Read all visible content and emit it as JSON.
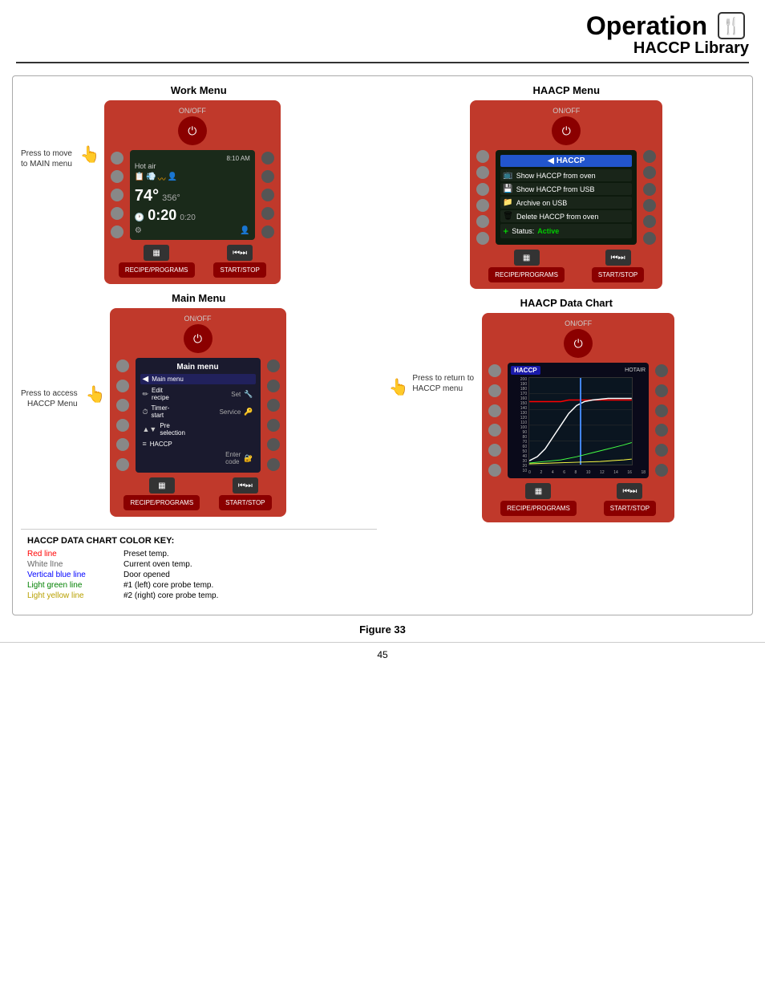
{
  "header": {
    "title": "Operation",
    "subtitle": "HACCP Library",
    "icon_alt": "chef-hat-icon"
  },
  "work_menu": {
    "label": "Work Menu",
    "onoff": "ON/OFF",
    "time": "8:10 AM",
    "hotair": "Hot air",
    "temp": "74°",
    "temp_sub": "356°",
    "timer": "0:20",
    "timer_sub": "0:20",
    "recipe_btn": "RECIPE/PROGRAMS",
    "start_btn": "START/STOP",
    "press_label": "Press to move\nto MAIN menu"
  },
  "haacp_menu": {
    "label": "HAACP Menu",
    "onoff": "ON/OFF",
    "title": "HACCP",
    "items": [
      {
        "icon": "📋",
        "text": "Show HACCP from oven"
      },
      {
        "icon": "💾",
        "text": "Show HACCP from USB"
      },
      {
        "icon": "📁",
        "text": "Archive on USB"
      },
      {
        "icon": "🗑",
        "text": "Delete HACCP from oven"
      },
      {
        "icon": "+",
        "text": "Status:",
        "value": "Active",
        "is_status": true
      }
    ],
    "recipe_btn": "RECIPE/PROGRAMS",
    "start_btn": "START/STOP"
  },
  "main_menu": {
    "label": "Main Menu",
    "onoff": "ON/OFF",
    "title": "Main menu",
    "items": [
      {
        "icon": "◀",
        "text": "Main menu"
      },
      {
        "icon": "✏",
        "text": "Edit recipe",
        "right": "Set"
      },
      {
        "icon": "⏱",
        "text": "Timer-start",
        "right": "Service"
      },
      {
        "icon": "▲",
        "text": "Pre selection"
      },
      {
        "icon": "=",
        "text": "HACCP"
      },
      {
        "icon": "→",
        "text": "",
        "right": "Enter code"
      }
    ],
    "recipe_btn": "RECIPE/PROGRAMS",
    "start_btn": "START/STOP",
    "press_label": "Press to access\nHACCP Menu"
  },
  "haacp_data_chart": {
    "label": "HAACP Data Chart",
    "onoff": "ON/OFF",
    "chart_title": "HACCP",
    "chart_subtitle": "HOTAIR",
    "recipe_btn": "RECIPE/PROGRAMS",
    "start_btn": "START/STOP",
    "press_label": "Press to return to\nHACCP menu",
    "y_labels": [
      "200",
      "190",
      "180",
      "170",
      "160",
      "150",
      "140",
      "130",
      "120",
      "110",
      "100",
      "90",
      "80",
      "70",
      "60",
      "50",
      "40",
      "30",
      "20",
      "10"
    ],
    "x_labels": [
      "0",
      "2",
      "4",
      "6",
      "8",
      "10",
      "12",
      "14",
      "16",
      "18"
    ]
  },
  "legend": {
    "title": "HACCP DATA CHART COLOR KEY:",
    "items": [
      {
        "key": "Red line",
        "color": "red",
        "value": "Preset temp."
      },
      {
        "key": "White lIne",
        "color": "white-line",
        "value": "Current oven temp."
      },
      {
        "key": "Vertical blue line",
        "color": "blue",
        "value": "Door opened"
      },
      {
        "key": "Light green line",
        "color": "green",
        "value": "#1 (left) core probe temp."
      },
      {
        "key": "Light yellow line",
        "color": "yellow",
        "value": "#2 (right) core probe temp."
      }
    ]
  },
  "figure": {
    "caption": "Figure 33",
    "page": "45"
  }
}
